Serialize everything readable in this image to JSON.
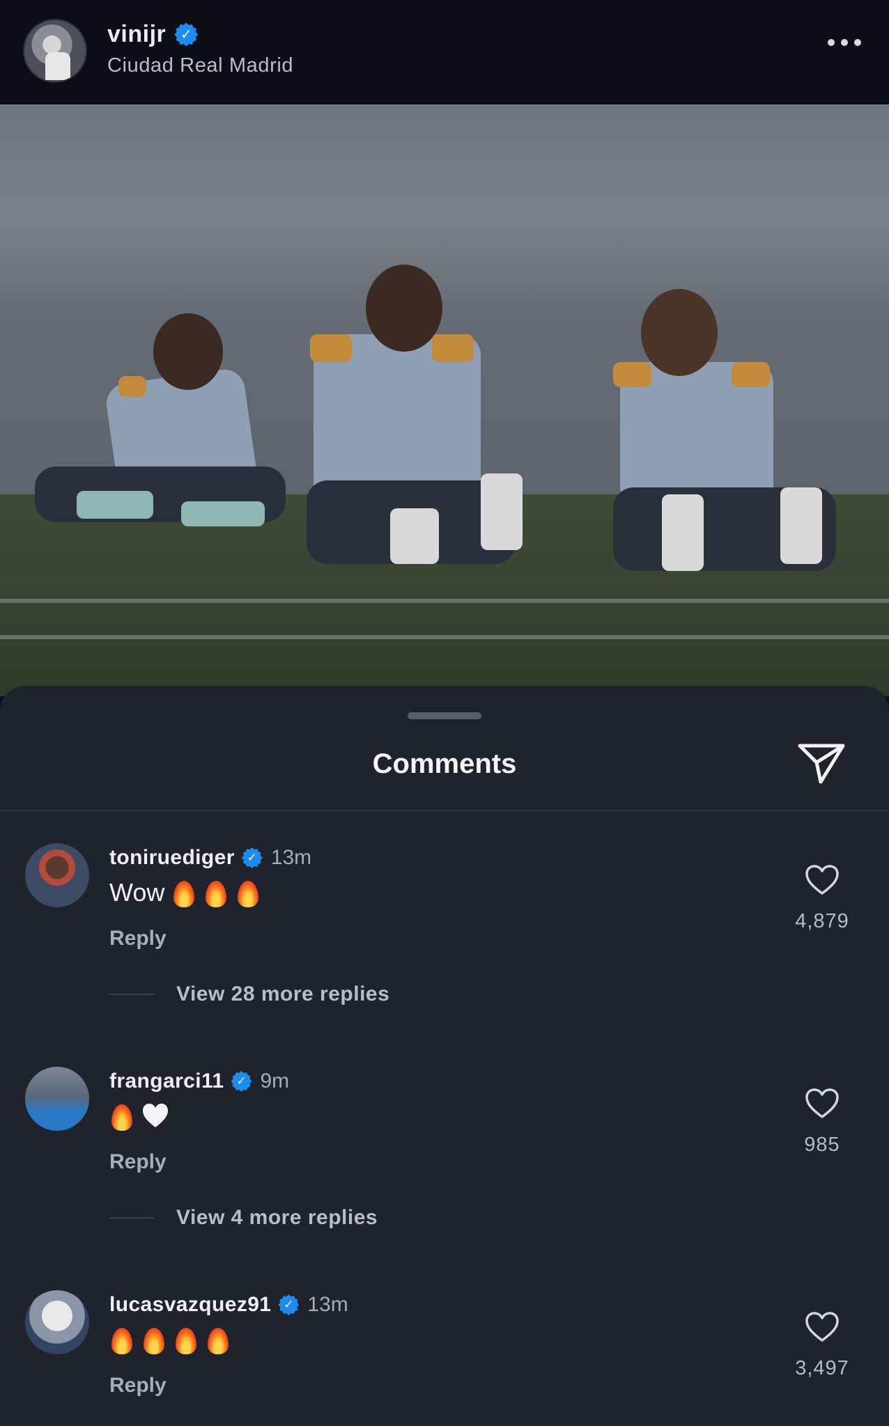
{
  "header": {
    "username": "vinijr",
    "subtitle": "Ciudad Real Madrid"
  },
  "sheet": {
    "title": "Comments"
  },
  "comments": [
    {
      "username": "toniruediger",
      "time": "13m",
      "text_prefix": "Wow",
      "emojis": [
        "fire",
        "fire",
        "fire"
      ],
      "reply_label": "Reply",
      "likes": "4,879",
      "view_more": "View 28 more replies"
    },
    {
      "username": "frangarci11",
      "time": "9m",
      "text_prefix": "",
      "emojis": [
        "fire",
        "white-heart"
      ],
      "reply_label": "Reply",
      "likes": "985",
      "view_more": "View 4 more replies"
    },
    {
      "username": "lucasvazquez91",
      "time": "13m",
      "text_prefix": "",
      "emojis": [
        "fire",
        "fire",
        "fire",
        "fire"
      ],
      "reply_label": "Reply",
      "likes": "3,497"
    }
  ],
  "icons": {
    "verified": "verified-badge-icon",
    "more": "more-horizontal-icon",
    "send": "send-icon",
    "like": "heart-outline-icon"
  },
  "colors": {
    "background": "#1f232b",
    "header": "#0b0e15",
    "verified": "#1d8cf2",
    "secondary_text": "#a8aeb7"
  }
}
